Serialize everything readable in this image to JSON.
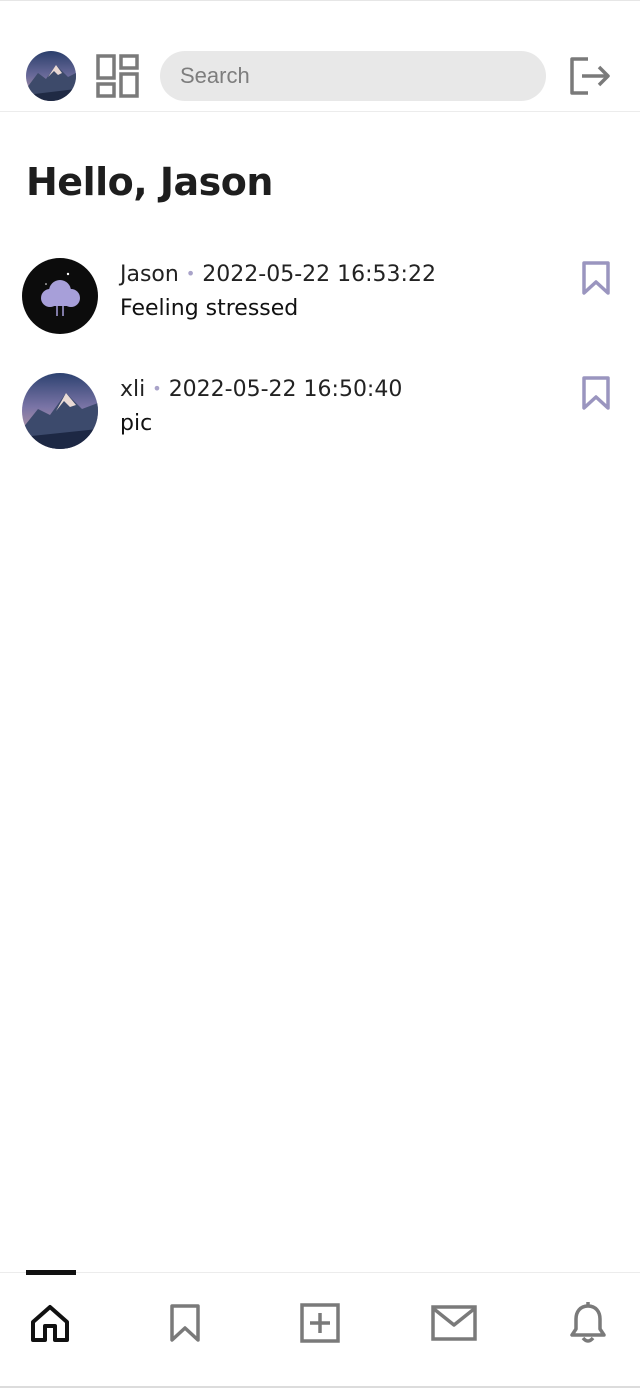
{
  "header": {
    "avatar": "profile-avatar-mountain",
    "grid_icon": "dashboard-grid-icon",
    "search_placeholder": "Search",
    "logout_icon": "logout-icon"
  },
  "greeting": "Hello, Jason",
  "posts": [
    {
      "author": "Jason",
      "separator": "•",
      "timestamp": "2022-05-22 16:53:22",
      "text": "Feeling stressed",
      "avatar": "cloud-avatar",
      "bookmark_icon": "bookmark-icon"
    },
    {
      "author": "xli",
      "separator": "•",
      "timestamp": "2022-05-22 16:50:40",
      "text": "pic",
      "avatar": "mountain-avatar",
      "bookmark_icon": "bookmark-icon"
    }
  ],
  "bottom_nav": {
    "items": [
      {
        "icon": "home-icon",
        "active": true
      },
      {
        "icon": "bookmark-icon",
        "active": false
      },
      {
        "icon": "add-post-icon",
        "active": false
      },
      {
        "icon": "mail-icon",
        "active": false
      },
      {
        "icon": "bell-icon",
        "active": false
      }
    ]
  },
  "colors": {
    "icon_gray": "#7a7a7a",
    "bookmark_accent": "#9a95bf",
    "active_black": "#111111",
    "search_bg": "#e8e8e8"
  }
}
